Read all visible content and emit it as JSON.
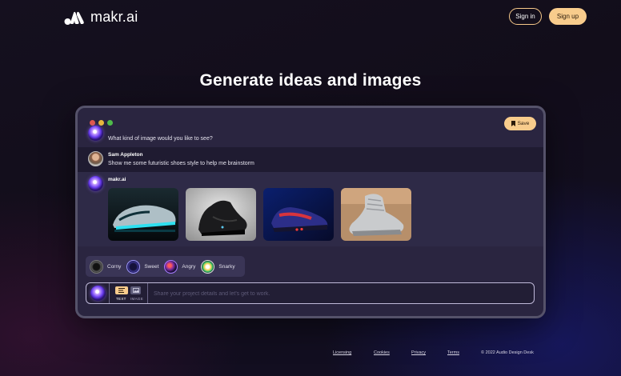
{
  "header": {
    "brand": "makr.ai",
    "signin_label": "Sign in",
    "signup_label": "Sign up"
  },
  "hero": {
    "title": "Generate ideas and images"
  },
  "app": {
    "save_label": "Save",
    "messages": [
      {
        "text": "What kind of image would you like to see?"
      },
      {
        "author": "Sam Appleton",
        "text": "Show me some futuristic shoes style to help me brainstorm"
      },
      {
        "author": "makr.ai"
      }
    ],
    "moods": [
      {
        "label": "Corny",
        "icon": "corny-mood-icon"
      },
      {
        "label": "Sweet",
        "icon": "sweet-mood-icon"
      },
      {
        "label": "Angry",
        "icon": "angry-mood-icon"
      },
      {
        "label": "Snarky",
        "icon": "snarky-mood-icon"
      }
    ],
    "composer": {
      "mode_text": "TEXT",
      "mode_image": "IMAGE",
      "placeholder": "Share your project details and let's get to work."
    }
  },
  "footer": {
    "links": [
      "Licensing",
      "Cookies",
      "Privacy",
      "Terms"
    ],
    "copyright": "© 2022 Audio Design Desk"
  },
  "colors": {
    "accent": "#f8cc8c",
    "background": "#120d1a",
    "panel": "#2a2540"
  }
}
